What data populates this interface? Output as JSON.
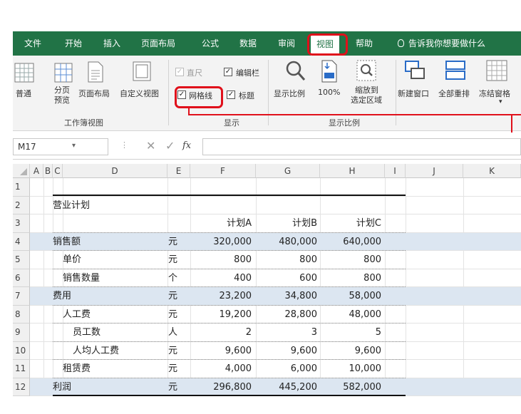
{
  "ribbon_tabs": [
    {
      "label": "文件"
    },
    {
      "label": "开始"
    },
    {
      "label": "插入"
    },
    {
      "label": "页面布局"
    },
    {
      "label": "公式"
    },
    {
      "label": "数据"
    },
    {
      "label": "审阅"
    },
    {
      "label": "视图",
      "active": true
    },
    {
      "label": "帮助"
    }
  ],
  "tell_me": "告诉我你想要做什么",
  "ribbon": {
    "workbook_views": {
      "normal": "普通",
      "page_break_line1": "分页",
      "page_break_line2": "预览",
      "page_layout": "页面布局",
      "custom_views": "自定义视图",
      "group_label": "工作簿视图"
    },
    "show": {
      "ruler": "直尺",
      "ruler_checked": true,
      "formula_bar": "编辑栏",
      "formula_bar_checked": true,
      "gridlines": "网格线",
      "gridlines_checked": true,
      "headings": "标题",
      "headings_checked": true,
      "group_label": "显示"
    },
    "zoom": {
      "zoom": "显示比例",
      "zoom100": "100%",
      "zoom_selection_line1": "缩放到",
      "zoom_selection_line2": "选定区域",
      "group_label": "显示比例"
    },
    "window": {
      "new_window": "新建窗口",
      "arrange_all": "全部重排",
      "freeze_panes": "冻结窗格"
    }
  },
  "formula_bar": {
    "name_box": "M17",
    "fx": "fx",
    "value": ""
  },
  "columns": [
    "A",
    "B",
    "C",
    "D",
    "E",
    "F",
    "G",
    "H",
    "I",
    "J",
    "K"
  ],
  "rows": [
    {
      "n": "1",
      "label": "",
      "unit": "",
      "a": "",
      "b": "",
      "c": "",
      "indent": 0,
      "blue": false
    },
    {
      "n": "2",
      "label": "营业计划",
      "unit": "",
      "a": "",
      "b": "",
      "c": "",
      "indent": 0,
      "blue": false
    },
    {
      "n": "3",
      "label": "",
      "unit": "",
      "a": "计划A",
      "b": "计划B",
      "c": "计划C",
      "indent": 0,
      "blue": false
    },
    {
      "n": "4",
      "label": "销售额",
      "unit": "元",
      "a": "320,000",
      "b": "480,000",
      "c": "640,000",
      "indent": 0,
      "blue": true
    },
    {
      "n": "5",
      "label": "单价",
      "unit": "元",
      "a": "800",
      "b": "800",
      "c": "800",
      "indent": 1,
      "blue": false
    },
    {
      "n": "6",
      "label": "销售数量",
      "unit": "个",
      "a": "400",
      "b": "600",
      "c": "800",
      "indent": 1,
      "blue": false
    },
    {
      "n": "7",
      "label": "费用",
      "unit": "元",
      "a": "23,200",
      "b": "34,800",
      "c": "58,000",
      "indent": 0,
      "blue": true
    },
    {
      "n": "8",
      "label": "人工费",
      "unit": "元",
      "a": "19,200",
      "b": "28,800",
      "c": "48,000",
      "indent": 1,
      "blue": false
    },
    {
      "n": "9",
      "label": "员工数",
      "unit": "人",
      "a": "2",
      "b": "3",
      "c": "5",
      "indent": 2,
      "blue": false
    },
    {
      "n": "10",
      "label": "人均人工费",
      "unit": "元",
      "a": "9,600",
      "b": "9,600",
      "c": "9,600",
      "indent": 2,
      "blue": false
    },
    {
      "n": "11",
      "label": "租赁费",
      "unit": "元",
      "a": "4,000",
      "b": "6,000",
      "c": "10,000",
      "indent": 1,
      "blue": false
    },
    {
      "n": "12",
      "label": "利润",
      "unit": "元",
      "a": "296,800",
      "b": "445,200",
      "c": "582,000",
      "indent": 0,
      "blue": true
    }
  ],
  "colors": {
    "ribbon_green": "#217346",
    "highlight_red": "#e0101b",
    "row_blue": "#dce6f1"
  }
}
